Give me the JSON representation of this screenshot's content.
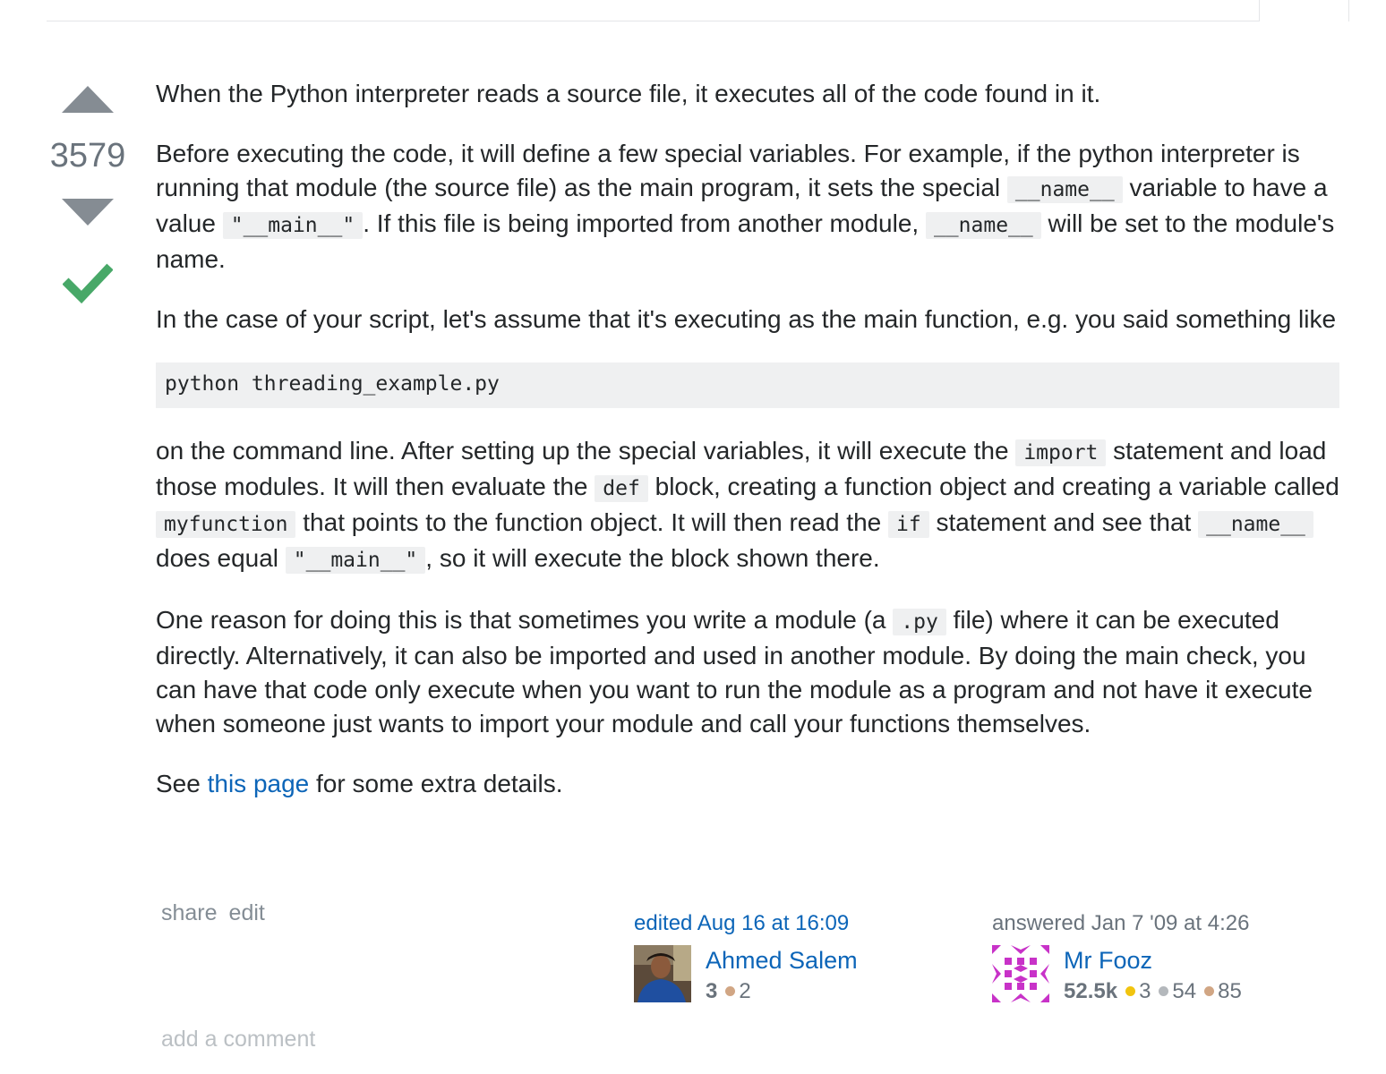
{
  "vote": {
    "count": "3579"
  },
  "post": {
    "p1": "When the Python interpreter reads a source file, it executes all of the code found in it.",
    "p2": {
      "t1": "Before executing the code, it will define a few special variables. For example, if the python interpreter is running that module (the source file) as the main program, it sets the special ",
      "c1": "__name__",
      "t2": " variable to have a value ",
      "c2": "\"__main__\"",
      "t3": ". If this file is being imported from another module, ",
      "c3": "__name__",
      "t4": " will be set to the module's name."
    },
    "p3": "In the case of your script, let's assume that it's executing as the main function, e.g. you said something like",
    "codeblock": "python threading_example.py",
    "p4": {
      "t1": "on the command line. After setting up the special variables, it will execute the ",
      "c1": "import",
      "t2": " statement and load those modules. It will then evaluate the ",
      "c2": "def",
      "t3": " block, creating a function object and creating a variable called ",
      "c3": "myfunction",
      "t4": " that points to the function object. It will then read the ",
      "c4": "if",
      "t5": " statement and see that ",
      "c5": "__name__",
      "t6": " does equal ",
      "c6": "\"__main__\"",
      "t7": ", so it will execute the block shown there."
    },
    "p5": {
      "t1": "One reason for doing this is that sometimes you write a module (a ",
      "c1": ".py",
      "t2": " file) where it can be executed directly. Alternatively, it can also be imported and used in another module. By doing the main check, you can have that code only execute when you want to run the module as a program and not have it execute when someone just wants to import your module and call your functions themselves."
    },
    "p6": {
      "t1": "See ",
      "link": "this page",
      "t2": " for some extra details."
    }
  },
  "menu": {
    "share": "share",
    "edit": "edit"
  },
  "edited": {
    "action": "edited Aug 16 at 16:09",
    "user": "Ahmed Salem",
    "rep": "3",
    "bronze": "2"
  },
  "answered": {
    "action": "answered Jan 7 '09 at 4:26",
    "user": "Mr Fooz",
    "rep": "52.5k",
    "gold": "3",
    "silver": "54",
    "bronze": "85"
  },
  "add_comment": "add a comment",
  "colors": {
    "link": "#0c65b8",
    "accepted": "#48a868",
    "arrow": "#858c93",
    "gold": "#f1c40f",
    "silver": "#b4b8bc",
    "bronze": "#d1a684",
    "identicon": "#c832c8"
  },
  "icons": {
    "upvote": "arrow-up-icon",
    "downvote": "arrow-down-icon",
    "accepted": "checkmark-icon"
  }
}
